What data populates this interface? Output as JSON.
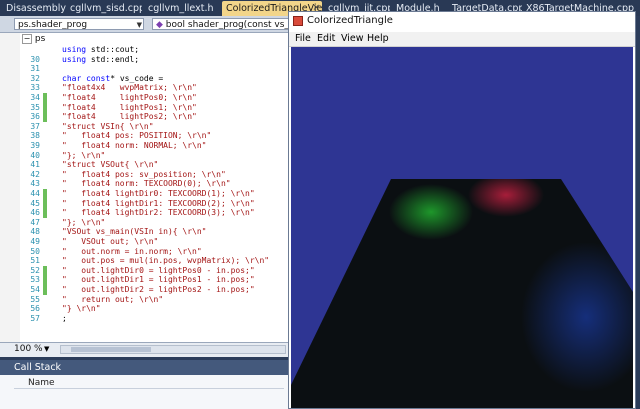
{
  "tabs": [
    {
      "label": "Disassembly"
    },
    {
      "label": "cgllvm_sisd.cpp"
    },
    {
      "label": "cgllvm_llext.h"
    },
    {
      "label": "ColorizedTriangleView.h"
    },
    {
      "label": "cgllvm_jit.cpp"
    },
    {
      "label": "Module.h"
    },
    {
      "label": "TargetData.cpp"
    },
    {
      "label": "X86TargetMachine.cpp"
    }
  ],
  "active_tab_close": "×",
  "nav": {
    "scope": "ps.shader_prog",
    "member": "bool shader_prog(const vs_output"
  },
  "outline": {
    "label": "ps",
    "collapse_symbol": "−"
  },
  "code_lines": [
    {
      "n": "",
      "t": "using std::cout;"
    },
    {
      "n": "30",
      "t": "using std::endl;"
    },
    {
      "n": "31",
      "t": ""
    },
    {
      "n": "32",
      "t": "char const* vs_code ="
    },
    {
      "n": "33",
      "t": "\"float4x4   wvpMatrix; \\r\\n\""
    },
    {
      "n": "34",
      "t": "\"float4     lightPos0; \\r\\n\""
    },
    {
      "n": "35",
      "t": "\"float4     lightPos1; \\r\\n\""
    },
    {
      "n": "36",
      "t": "\"float4     lightPos2; \\r\\n\""
    },
    {
      "n": "37",
      "t": "\"struct VSIn{ \\r\\n\""
    },
    {
      "n": "38",
      "t": "\"   float4 pos: POSITION; \\r\\n\""
    },
    {
      "n": "39",
      "t": "\"   float4 norm: NORMAL; \\r\\n\""
    },
    {
      "n": "40",
      "t": "\"}; \\r\\n\""
    },
    {
      "n": "41",
      "t": "\"struct VSOut{ \\r\\n\""
    },
    {
      "n": "42",
      "t": "\"   float4 pos: sv_position; \\r\\n\""
    },
    {
      "n": "43",
      "t": "\"   float4 norm: TEXCOORD(0); \\r\\n\""
    },
    {
      "n": "44",
      "t": "\"   float4 lightDir0: TEXCOORD(1); \\r\\n\""
    },
    {
      "n": "45",
      "t": "\"   float4 lightDir1: TEXCOORD(2); \\r\\n\""
    },
    {
      "n": "46",
      "t": "\"   float4 lightDir2: TEXCOORD(3); \\r\\n\""
    },
    {
      "n": "47",
      "t": "\"}; \\r\\n\""
    },
    {
      "n": "48",
      "t": "\"VSOut vs_main(VSIn in){ \\r\\n\""
    },
    {
      "n": "49",
      "t": "\"   VSOut out; \\r\\n\""
    },
    {
      "n": "50",
      "t": "\"   out.norm = in.norm; \\r\\n\""
    },
    {
      "n": "51",
      "t": "\"   out.pos = mul(in.pos, wvpMatrix); \\r\\n\""
    },
    {
      "n": "52",
      "t": "\"   out.lightDir0 = lightPos0 - in.pos;\""
    },
    {
      "n": "53",
      "t": "\"   out.lightDir1 = lightPos1 - in.pos;\""
    },
    {
      "n": "54",
      "t": "\"   out.lightDir2 = lightPos2 - in.pos;\""
    },
    {
      "n": "55",
      "t": "\"   return out; \\r\\n\""
    },
    {
      "n": "56",
      "t": "\"} \\r\\n\""
    },
    {
      "n": "57",
      "t": ";"
    }
  ],
  "changed_line_numbers": [
    "34",
    "35",
    "36",
    "44",
    "45",
    "46",
    "52",
    "53",
    "54"
  ],
  "zoom": {
    "label": "100 %"
  },
  "callstack": {
    "title": "Call Stack",
    "column": "Name"
  },
  "window": {
    "title": "ColorizedTriangle",
    "menus": [
      "File",
      "Edit",
      "View",
      "Help"
    ]
  },
  "scene": {
    "background": "#2e3593",
    "floor": "#0b0f12",
    "light_colors": [
      "#1f9e2c",
      "#b81f3e",
      "#1a3ca8"
    ]
  },
  "colors": {
    "tab_bar": "#293955",
    "active_tab": "#f2d58a",
    "string_literal": "#a31515",
    "keyword": "#0000ff",
    "line_number": "#2b91af",
    "change_marker": "#6cbe5a"
  }
}
